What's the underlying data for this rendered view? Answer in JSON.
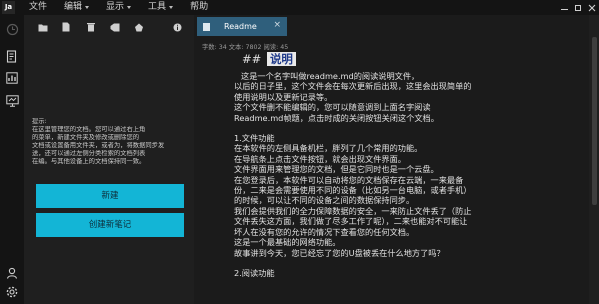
{
  "app": {
    "logo_text": "Ja",
    "menu": [
      {
        "label": "文件",
        "has_dropdown": false
      },
      {
        "label": "编辑",
        "has_dropdown": true
      },
      {
        "label": "显示",
        "has_dropdown": true
      },
      {
        "label": "工具",
        "has_dropdown": true
      },
      {
        "label": "帮助",
        "has_dropdown": false
      }
    ]
  },
  "activity_bar": {
    "icons": [
      "history-icon",
      "documents-icon",
      "statistics-icon",
      "monitor-icon",
      "user-icon",
      "settings-icon"
    ]
  },
  "left_panel": {
    "toolbar_icons": [
      "folder-icon",
      "new-file-icon",
      "delete-icon",
      "tag-icon",
      "share-icon",
      "info-icon"
    ],
    "tip_lines": [
      "提示:",
      "在这里管理您的文档。您可以通过右上角",
      "的菜单，新建文件夹及修改或删除您的",
      "文档或设置备用文件夹，或者为，将数据同步发",
      "送，还可以通过左侧分类检索的文档列表",
      "在编。与其他设备上的文档保持同一致。"
    ],
    "primary_button": "新建",
    "secondary_button": "创建新笔记"
  },
  "editor": {
    "tab_label": "Readme",
    "tab_close": "×",
    "status": "字数: 34  文本: 7802  阅读: 45",
    "heading_hash": "##",
    "heading_word": "说明",
    "lines": [
      {
        "text": "这是一个名字叫做readme.md的阅读说明文件，",
        "indent": true,
        "gap": false
      },
      {
        "text": "以后的日子里，这个文件会在每次更新后出现，这里会出现简单的",
        "indent": false,
        "gap": false
      },
      {
        "text": "使用说明以及更新记录等。",
        "indent": false,
        "gap": false
      },
      {
        "text": "这个文件删不能编辑的，您可以随意调到上面名字阅读",
        "indent": false,
        "gap": false
      },
      {
        "text": "Readme.md帧题，点击时成的关闭按钮关闭这个文档。",
        "indent": false,
        "gap": false
      },
      {
        "text": "1.文件功能",
        "indent": false,
        "gap": true
      },
      {
        "text": "在本软件的左侧具备机栏，胖列了几个常用的功能。",
        "indent": false,
        "gap": false
      },
      {
        "text": "在导航条上点击文件按钮，就会出现文件界面。",
        "indent": false,
        "gap": false
      },
      {
        "text": "文件界面用来管理您的文档，但是它同时也是一个云盘。",
        "indent": false,
        "gap": false
      },
      {
        "text": "在您登录后，本软件可以自动将您的文档保存在云端，一来最备",
        "indent": false,
        "gap": false
      },
      {
        "text": "份，二来是会需要使用不同的设备（比如另一台电脑，或者手机）",
        "indent": false,
        "gap": false
      },
      {
        "text": "的时候，可以让不同的设备之间的数据保持同步。",
        "indent": false,
        "gap": false
      },
      {
        "text": "我们会提供我们的全力保障数据的安全，一来防止文件丢了（防止",
        "indent": false,
        "gap": false
      },
      {
        "text": "文件丢失这方面，我们做了尽多工作了呢），二来也能对不可能让",
        "indent": false,
        "gap": false
      },
      {
        "text": "坏人在没有您的允许的情况下查看您的任何文档。",
        "indent": false,
        "gap": false
      },
      {
        "text": "这是一个最基础的网络功能。",
        "indent": false,
        "gap": false
      },
      {
        "text": "故事讲到今天，您已经忘了您的U盘被丢在什么地方了吗？",
        "indent": false,
        "gap": false
      },
      {
        "text": "2.阅读功能",
        "indent": false,
        "gap": true
      }
    ]
  },
  "colors": {
    "accent": "#13b5d6",
    "tab_active": "#2f5f7c",
    "background": "#1b1b1b",
    "panel": "#1f1f1f"
  }
}
